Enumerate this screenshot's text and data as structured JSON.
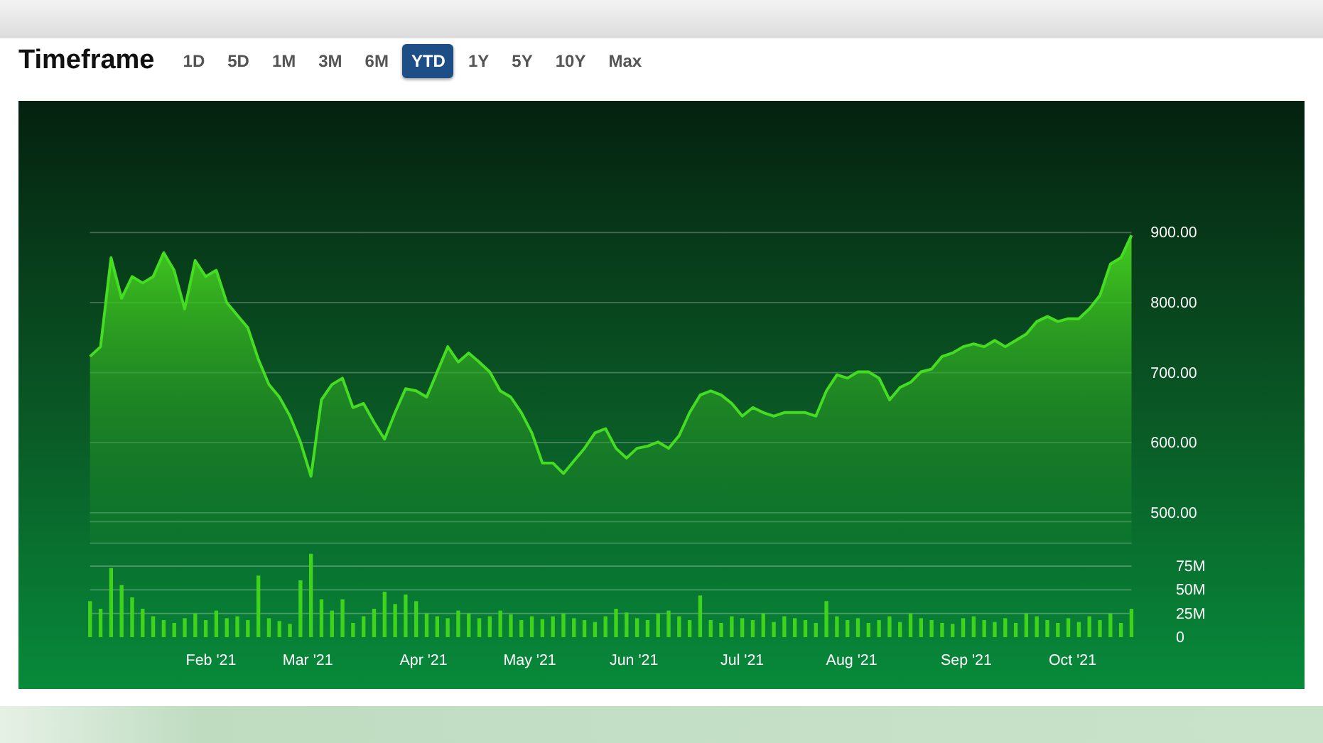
{
  "header": {
    "title": "Timeframe"
  },
  "tabs": [
    {
      "label": "1D",
      "selected": false
    },
    {
      "label": "5D",
      "selected": false
    },
    {
      "label": "1M",
      "selected": false
    },
    {
      "label": "3M",
      "selected": false
    },
    {
      "label": "6M",
      "selected": false
    },
    {
      "label": "YTD",
      "selected": true
    },
    {
      "label": "1Y",
      "selected": false
    },
    {
      "label": "5Y",
      "selected": false
    },
    {
      "label": "10Y",
      "selected": false
    },
    {
      "label": "Max",
      "selected": false
    }
  ],
  "price_chart": {
    "chart_data": {
      "type": "area",
      "grid": true,
      "ylim": [
        500,
        900
      ],
      "yticks": [
        {
          "value": 900,
          "label": "900.00"
        },
        {
          "value": 800,
          "label": "800.00"
        },
        {
          "value": 700,
          "label": "700.00"
        },
        {
          "value": 600,
          "label": "600.00"
        },
        {
          "value": 500,
          "label": "500.00"
        }
      ],
      "series": [
        {
          "color": "#44dd22",
          "values": [
            723,
            737,
            864,
            806,
            837,
            828,
            837,
            871,
            846,
            791,
            860,
            837,
            846,
            800,
            782,
            764,
            719,
            683,
            665,
            638,
            601,
            552,
            661,
            683,
            692,
            650,
            656,
            629,
            605,
            643,
            677,
            674,
            665,
            701,
            737,
            715,
            728,
            715,
            701,
            674,
            665,
            643,
            614,
            571,
            571,
            556,
            574,
            592,
            614,
            620,
            592,
            578,
            592,
            595,
            601,
            592,
            610,
            643,
            668,
            674,
            668,
            656,
            638,
            650,
            643,
            638,
            643,
            643,
            643,
            638,
            674,
            697,
            692,
            701,
            701,
            692,
            661,
            679,
            686,
            701,
            705,
            723,
            728,
            737,
            741,
            737,
            746,
            737,
            746,
            755,
            773,
            780,
            773,
            777,
            777,
            791,
            810,
            855,
            864,
            896
          ]
        }
      ]
    }
  },
  "volume_chart": {
    "month_labels": [
      "Feb '21",
      "Mar '21",
      "Apr '21",
      "May '21",
      "Jun '21",
      "Jul '21",
      "Aug '21",
      "Sep '21",
      "Oct '21"
    ],
    "chart_data": {
      "type": "bar",
      "grid": true,
      "ylim": [
        0,
        90
      ],
      "yticks": [
        {
          "value": 75,
          "label": "75M"
        },
        {
          "value": 50,
          "label": "50M"
        },
        {
          "value": 25,
          "label": "25M"
        },
        {
          "value": 0,
          "label": "0"
        }
      ],
      "series": [
        {
          "color": "#3fd31c",
          "values": [
            38,
            30,
            73,
            55,
            42,
            30,
            22,
            18,
            15,
            20,
            25,
            18,
            28,
            20,
            22,
            18,
            65,
            20,
            17,
            14,
            60,
            88,
            40,
            28,
            40,
            15,
            22,
            30,
            48,
            35,
            45,
            38,
            25,
            22,
            20,
            28,
            25,
            20,
            22,
            28,
            24,
            18,
            22,
            19,
            22,
            25,
            20,
            18,
            16,
            22,
            30,
            26,
            20,
            18,
            25,
            28,
            22,
            18,
            44,
            18,
            15,
            22,
            20,
            18,
            25,
            16,
            22,
            20,
            18,
            15,
            38,
            22,
            18,
            20,
            15,
            18,
            22,
            16,
            25,
            20,
            18,
            15,
            14,
            20,
            22,
            18,
            16,
            20,
            15,
            25,
            22,
            18,
            15,
            20,
            16,
            22,
            18,
            25,
            15,
            30
          ]
        }
      ]
    }
  }
}
